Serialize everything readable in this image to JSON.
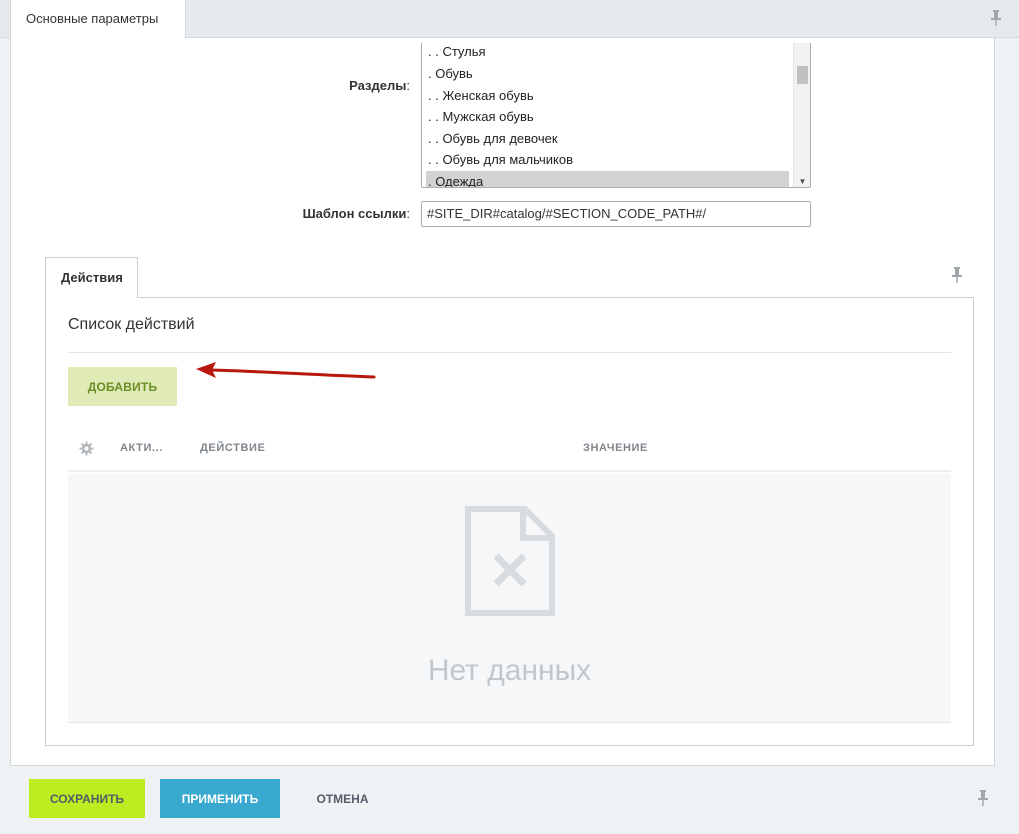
{
  "top_tab": {
    "label": "Основные параметры"
  },
  "sections_field": {
    "label": "Разделы",
    "colon": ":",
    "options": [
      ". . Стулья",
      ". Обувь",
      ". . Женская обувь",
      ". . Мужская обувь",
      ". . Обувь для девочек",
      ". . Обувь для мальчиков",
      ". Одежда"
    ],
    "selected": ". Одежда"
  },
  "link_template_field": {
    "label": "Шаблон ссылки",
    "colon": ":",
    "value": "#SITE_DIR#catalog/#SECTION_CODE_PATH#/"
  },
  "actions_tab": {
    "label": "Действия"
  },
  "actions_panel": {
    "title": "Список действий",
    "add_button": "ДОБАВИТЬ",
    "columns": [
      "АКТИ...",
      "ДЕЙСТВИЕ",
      "ЗНАЧЕНИЕ"
    ],
    "empty_text": "Нет данных"
  },
  "footer": {
    "save": "СОХРАНИТЬ",
    "apply": "ПРИМЕНИТЬ",
    "cancel": "ОТМЕНА"
  },
  "icons": {
    "pin": "pin-icon",
    "settings": "gear-icon",
    "empty": "no-data-document-icon",
    "annotation": "red-arrow"
  },
  "colors": {
    "save_button": "#bbed21",
    "apply_button": "#3aa9d0",
    "add_button": "#dfeab6",
    "annotation_arrow": "#b8180e"
  }
}
